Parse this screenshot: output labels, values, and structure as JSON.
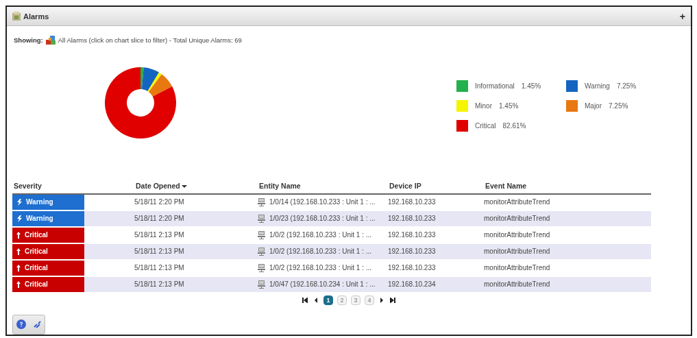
{
  "panel": {
    "title": "Alarms",
    "action": "+"
  },
  "filter": {
    "label": "Showing:",
    "text": "All Alarms (click on chart slice to filter) - Total Unique Alarms: 69"
  },
  "chart_data": {
    "type": "donut",
    "categories": [
      "Informational",
      "Warning",
      "Minor",
      "Major",
      "Critical"
    ],
    "values": [
      1.45,
      7.25,
      1.45,
      7.25,
      82.61
    ]
  },
  "legend": [
    {
      "value": "1.45%",
      "color": "#22b14c"
    },
    {
      "value": "7.25%",
      "color": "#1565c0"
    },
    {
      "value": "1.45%",
      "color": "#f5f500"
    },
    {
      "value": "7.25%",
      "color": "#e87810"
    },
    {
      "value": "82.61%",
      "color": "#e00000"
    }
  ],
  "table": {
    "columns": [
      {
        "label": "Severity",
        "sorted": false
      },
      {
        "label": "Date Opened",
        "sorted": true
      },
      {
        "label": "Entity Name",
        "sorted": false
      },
      {
        "label": "Device IP",
        "sorted": false
      },
      {
        "label": "Event Name",
        "sorted": false
      }
    ],
    "rows": [
      {
        "severity": "Warning",
        "kind": "warning",
        "date": "5/18/11 2:20 PM",
        "entity": "1/0/14 (192.168.10.233 : Unit 1 : ...",
        "ip": "192.168.10.233",
        "event": "monitorAttributeTrend"
      },
      {
        "severity": "Warning",
        "kind": "warning",
        "date": "5/18/11 2:20 PM",
        "entity": "1/0/23 (192.168.10.233 : Unit 1 : ...",
        "ip": "192.168.10.233",
        "event": "monitorAttributeTrend"
      },
      {
        "severity": "Critical",
        "kind": "critical",
        "date": "5/18/11 2:13 PM",
        "entity": "1/0/2 (192.168.10.233 : Unit 1 : ...",
        "ip": "192.168.10.233",
        "event": "monitorAttributeTrend"
      },
      {
        "severity": "Critical",
        "kind": "critical",
        "date": "5/18/11 2:13 PM",
        "entity": "1/0/2 (192.168.10.233 : Unit 1 : ...",
        "ip": "192.168.10.233",
        "event": "monitorAttributeTrend"
      },
      {
        "severity": "Critical",
        "kind": "critical",
        "date": "5/18/11 2:13 PM",
        "entity": "1/0/2 (192.168.10.233 : Unit 1 : ...",
        "ip": "192.168.10.233",
        "event": "monitorAttributeTrend"
      },
      {
        "severity": "Critical",
        "kind": "critical",
        "date": "5/18/11 2:13 PM",
        "entity": "1/0/47 (192.168.10.234 : Unit 1 : ...",
        "ip": "192.168.10.234",
        "event": "monitorAttributeTrend"
      }
    ]
  },
  "pager": {
    "pages": [
      {
        "label": "1",
        "selected": true
      },
      {
        "label": "2",
        "selected": false
      },
      {
        "label": "3",
        "selected": false
      },
      {
        "label": "4",
        "selected": false
      }
    ]
  }
}
